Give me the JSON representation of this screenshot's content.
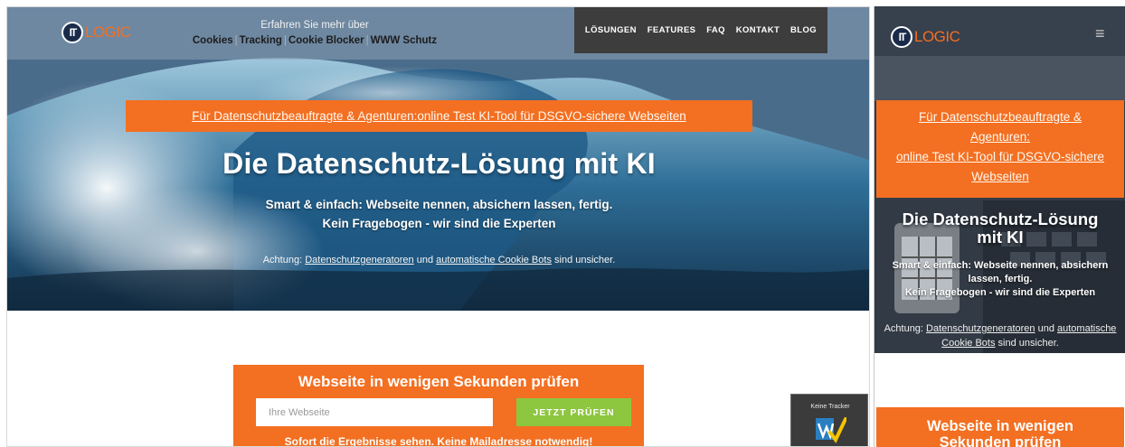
{
  "colors": {
    "brand_orange": "#f36f21",
    "nav_dark": "#3d3d3d",
    "cta_green": "#8dc63f",
    "logo_navy": "#1a2b4a"
  },
  "logo": {
    "mark": "IT",
    "text": "LOGIC"
  },
  "learn_more": {
    "title": "Erfahren Sie mehr über",
    "links": [
      "Cookies",
      "Tracking",
      "Cookie Blocker",
      "WWW Schutz"
    ],
    "separator": "|"
  },
  "nav": [
    "LÖSUNGEN",
    "FEATURES",
    "FAQ",
    "KONTAKT",
    "BLOG"
  ],
  "promo": {
    "text": "Für Datenschutzbeauftragte & Agenturen:online Test KI-Tool für DSGVO-sichere Webseiten",
    "mobile_line1": "Für Datenschutzbeauftragte &",
    "mobile_line2": "Agenturen:",
    "mobile_line3": "online Test KI-Tool für DSGVO-sichere",
    "mobile_line4": "Webseiten"
  },
  "hero": {
    "title": "Die Datenschutz-Lösung mit KI",
    "subtitle_line1": "Smart & einfach: Webseite nennen, absichern lassen, fertig.",
    "subtitle_line2": "Kein Fragebogen - wir sind die Experten",
    "warning_prefix": "Achtung:",
    "warning_link1": "Datenschutzgeneratoren",
    "warning_mid": "und",
    "warning_link2": "automatische Cookie Bots",
    "warning_suffix": "sind unsicher."
  },
  "mobile_hero": {
    "title_line1": "Die Datenschutz-Lösung",
    "title_line2": "mit KI",
    "sub_line1": "Smart & einfach: Webseite nennen, absichern",
    "sub_line2": "lassen, fertig.",
    "sub_line3": "Kein Fragebogen - wir sind die Experten",
    "warning_link2a": "automatische",
    "warning_link2b": "Cookie Bots"
  },
  "check": {
    "title": "Webseite in wenigen Sekunden prüfen",
    "placeholder": "Ihre Webseite",
    "button": "JETZT PRÜFEN",
    "note": "Sofort die Ergebnisse sehen. Keine Mailadresse notwendig!",
    "mobile_title_line1": "Webseite in wenigen",
    "mobile_title_line2": "Sekunden prüfen"
  },
  "badge": {
    "label": "Keine Tracker",
    "icon": "check-logo-icon"
  },
  "mobile_menu_icon": "hamburger-icon"
}
